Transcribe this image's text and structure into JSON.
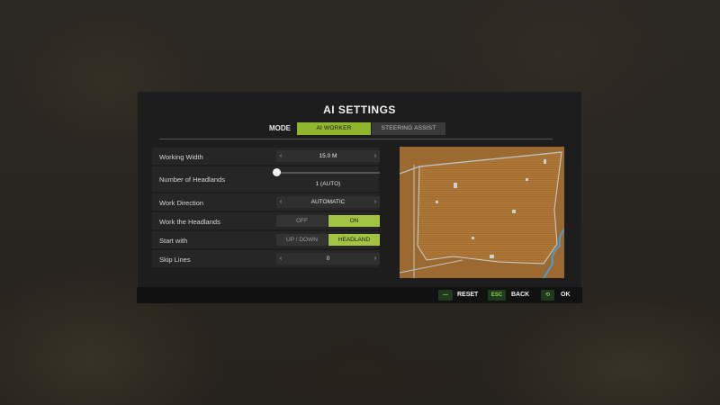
{
  "dialog": {
    "title": "AI SETTINGS"
  },
  "mode": {
    "label": "MODE",
    "options": [
      "AI WORKER",
      "STEERING ASSIST"
    ],
    "selected": "AI WORKER"
  },
  "settings": {
    "working_width": {
      "label": "Working Width",
      "value": "15.0 M"
    },
    "headlands": {
      "label": "Number of Headlands",
      "value": "1 (AUTO)",
      "slider_fraction": 0
    },
    "work_direction": {
      "label": "Work Direction",
      "value": "AUTOMATIC"
    },
    "work_headlands": {
      "label": "Work the Headlands",
      "options": [
        "OFF",
        "ON"
      ],
      "selected": "ON"
    },
    "start_with": {
      "label": "Start with",
      "options": [
        "UP / DOWN",
        "HEADLAND"
      ],
      "selected": "HEADLAND"
    },
    "skip_lines": {
      "label": "Skip Lines",
      "value": "0"
    }
  },
  "footer": {
    "reset": {
      "key": "—",
      "label": "RESET"
    },
    "back": {
      "key": "ESC",
      "label": "BACK"
    },
    "ok": {
      "key": "⟲",
      "label": "OK"
    }
  },
  "colors": {
    "accent": "#8fb62c",
    "field": "#a06a2e",
    "panel": "#1d1d1d"
  }
}
